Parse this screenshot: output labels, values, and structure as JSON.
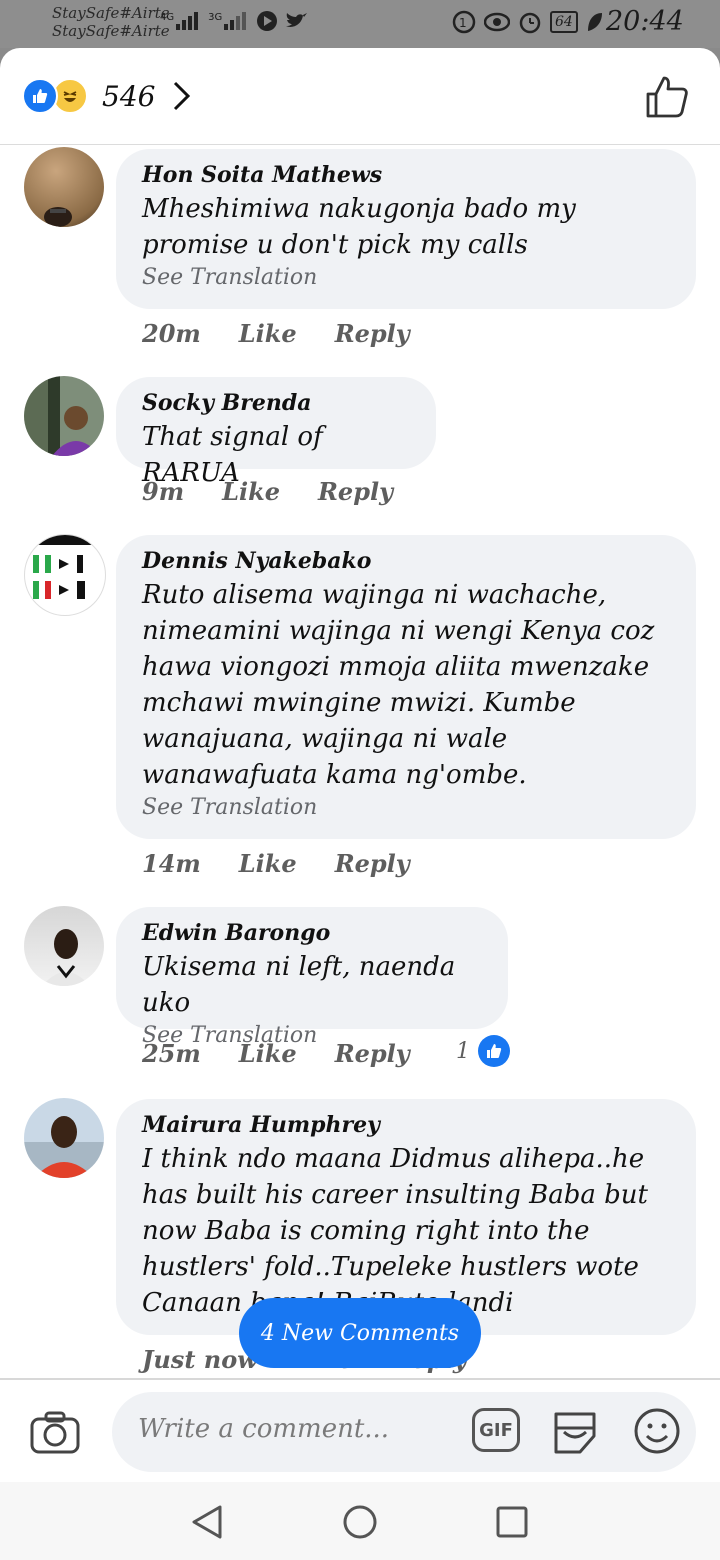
{
  "status_bar": {
    "carrier_1": "StaySafe#Airte",
    "carrier_2": "StaySafe#Airte",
    "signal_1": "4G",
    "signal_2": "3G",
    "battery": "64",
    "time": "20:44"
  },
  "header": {
    "reaction_icons": [
      "like-reaction-icon",
      "haha-reaction-icon"
    ],
    "reaction_count": "546"
  },
  "comments": [
    {
      "author": "Hon Soita Mathews",
      "text": "Mheshimiwa nakugonja bado my promise u don't pick my calls",
      "translation": "See Translation",
      "time": "20m",
      "like": "Like",
      "reply": "Reply"
    },
    {
      "author": "Socky Brenda",
      "text": "That signal of RARUA",
      "time": "9m",
      "like": "Like",
      "reply": "Reply"
    },
    {
      "author": "Dennis Nyakebako",
      "text": "Ruto alisema wajinga ni wachache, nimeamini wajinga ni wengi Kenya coz hawa viongozi mmoja aliita mwenzake mchawi mwingine mwizi. Kumbe wanajuana, wajinga ni wale wanawafuata kama ng'ombe.",
      "translation": "See Translation",
      "time": "14m",
      "like": "Like",
      "reply": "Reply"
    },
    {
      "author": "Edwin Barongo",
      "text": "Ukisema ni left, naenda uko",
      "translation": "See Translation",
      "time": "25m",
      "like": "Like",
      "reply": "Reply",
      "reaction_count": "1"
    },
    {
      "author": "Mairura Humphrey",
      "text": "I think ndo maana Didmus alihepa..he has built his career insulting Baba but now Baba is coming right into the hustlers' fold..Tupeleke hustlers wote Canaan bana! RaiRuto landi",
      "time": "Just now",
      "like": "Like",
      "reply": "Reply"
    }
  ],
  "new_comments_button": "4 New Comments",
  "composer": {
    "placeholder": "Write a comment...",
    "gif_label": "GIF"
  },
  "colors": {
    "accent": "#1877f2",
    "bubble": "#f0f2f5",
    "muted": "#65676b"
  }
}
